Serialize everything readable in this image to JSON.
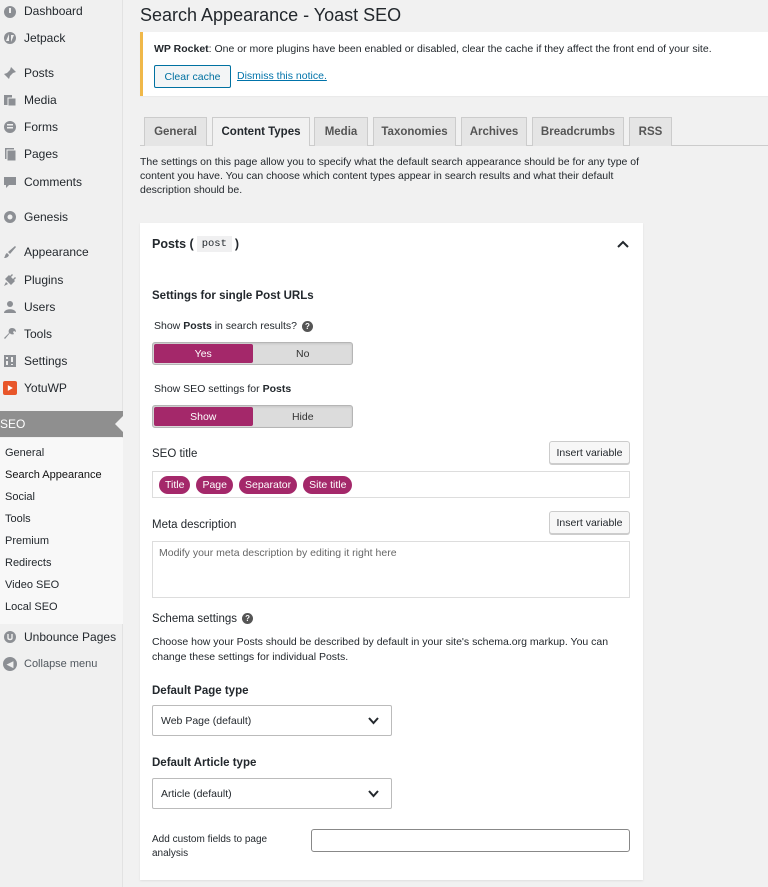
{
  "sidebar": {
    "items": [
      {
        "label": "Dashboard",
        "icon": "dashboard-icon"
      },
      {
        "label": "Jetpack",
        "icon": "jetpack-icon"
      },
      {
        "label": "Posts",
        "icon": "pin-icon"
      },
      {
        "label": "Media",
        "icon": "media-icon"
      },
      {
        "label": "Forms",
        "icon": "forms-icon"
      },
      {
        "label": "Pages",
        "icon": "pages-icon"
      },
      {
        "label": "Comments",
        "icon": "comment-icon"
      },
      {
        "label": "Genesis",
        "icon": "genesis-icon"
      },
      {
        "label": "Appearance",
        "icon": "brush-icon"
      },
      {
        "label": "Plugins",
        "icon": "plug-icon"
      },
      {
        "label": "Users",
        "icon": "user-icon"
      },
      {
        "label": "Tools",
        "icon": "wrench-icon"
      },
      {
        "label": "Settings",
        "icon": "settings-icon"
      },
      {
        "label": "YotuWP",
        "icon": "play-icon"
      }
    ],
    "seo_label": "SEO",
    "submenu": [
      "General",
      "Search Appearance",
      "Social",
      "Tools",
      "Premium",
      "Redirects",
      "Video SEO",
      "Local SEO"
    ],
    "unbounce_label": "Unbounce Pages",
    "collapse_label": "Collapse menu"
  },
  "page_title": "Search Appearance - Yoast SEO",
  "notice": {
    "bold": "WP Rocket",
    "message": ": One or more plugins have been enabled or disabled, clear the cache if they affect the front end of your site.",
    "clear_cache": "Clear cache",
    "dismiss": "Dismiss this notice."
  },
  "tabs": [
    "General",
    "Content Types",
    "Media",
    "Taxonomies",
    "Archives",
    "Breadcrumbs",
    "RSS"
  ],
  "active_tab": "Content Types",
  "intro": "The settings on this page allow you to specify what the default search appearance should be for any type of content you have. You can choose which content types appear in search results and what their default description should be.",
  "panel": {
    "title_prefix": "Posts (",
    "title_code": "post",
    "title_suffix": ")",
    "single_heading": "Settings for single Post URLs",
    "show_in_search_pre": "Show ",
    "show_in_search_bold": "Posts",
    "show_in_search_post": " in search results?",
    "toggle1": {
      "on": "Yes",
      "off": "No"
    },
    "show_seo_pre": "Show SEO settings for ",
    "show_seo_bold": "Posts",
    "toggle2": {
      "on": "Show",
      "off": "Hide"
    },
    "seo_title_label": "SEO title",
    "insert_variable": "Insert variable",
    "seo_title_pills": [
      "Title",
      "Page",
      "Separator",
      "Site title"
    ],
    "meta_label": "Meta description",
    "meta_placeholder": "Modify your meta description by editing it right here",
    "schema_heading": "Schema settings",
    "schema_text": "Choose how your Posts should be described by default in your site's schema.org markup. You can change these settings for individual Posts.",
    "page_type_label": "Default Page type",
    "page_type_value": "Web Page (default)",
    "article_type_label": "Default Article type",
    "article_type_value": "Article (default)",
    "custom_fields_label": "Add custom fields to page analysis"
  },
  "colors": {
    "accent": "#a4286a",
    "notice_border": "#f0b849",
    "link": "#0073aa"
  }
}
